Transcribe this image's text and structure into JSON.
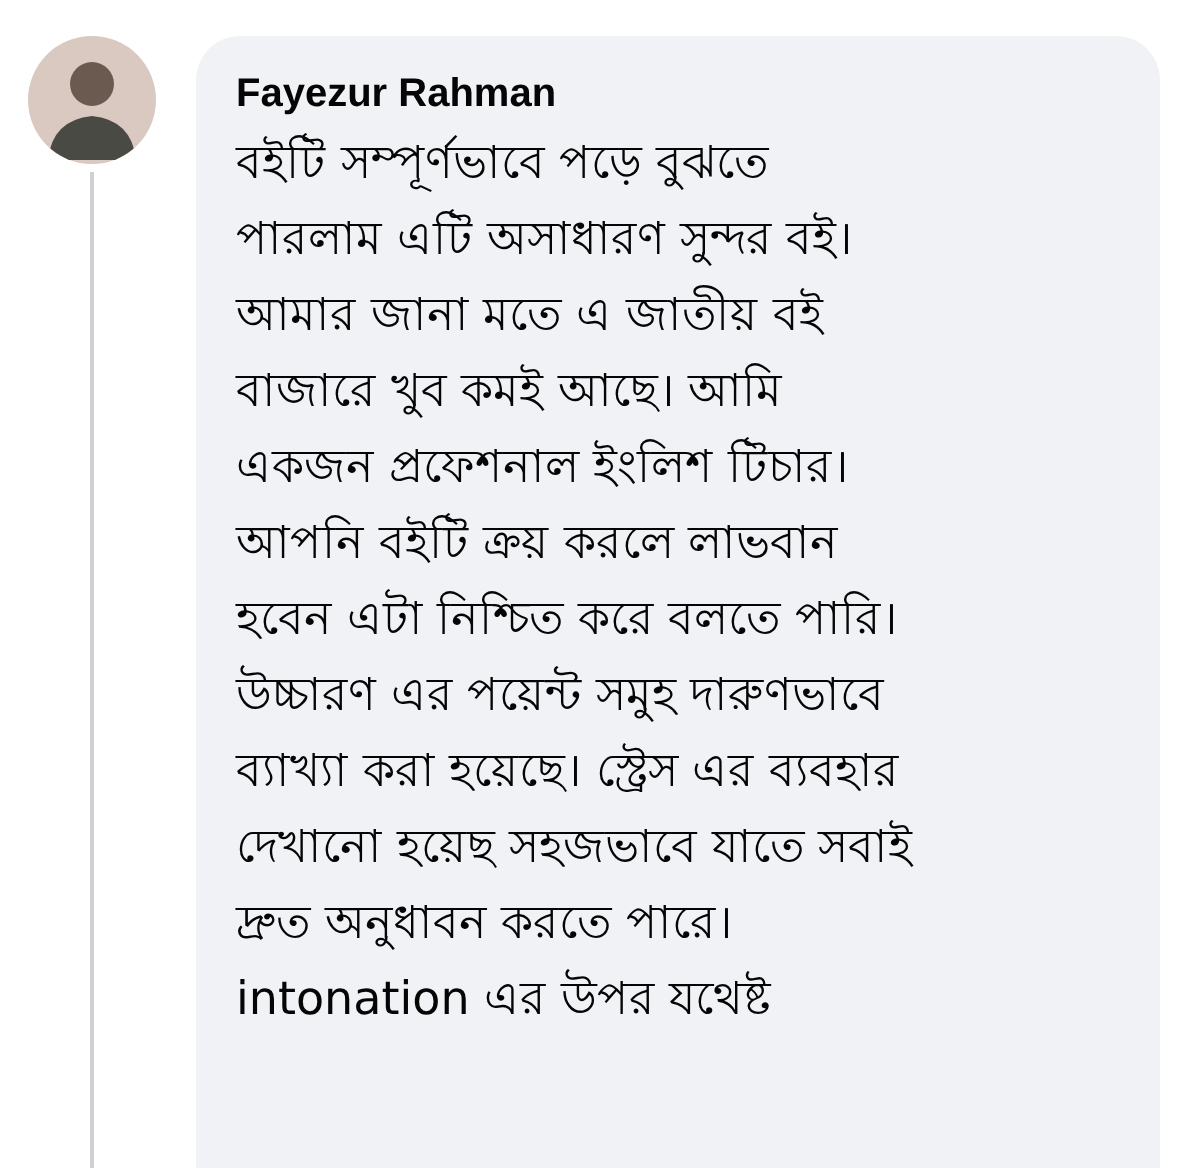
{
  "comment": {
    "author": "Fayezur Rahman",
    "text_lines": [
      "বইটি সম্পূর্ণভাবে পড়ে বুঝতে",
      "পারলাম এটি অসাধারণ সুন্দর বই।",
      "আমার জানা মতে এ জাতীয় বই",
      "বাজারে খুব কমই আছে। আমি",
      "একজন প্রফেশনাল ইংলিশ টিচার।",
      "আপনি বইটি ক্রয় করলে লাভবান",
      "হবেন এটা নিশ্চিত করে বলতে পারি।",
      "উচ্চারণ এর পয়েন্ট সমুহ দারুণভাবে",
      "ব্যাখ্যা করা হয়েছে। স্ট্রেস এর ব্যবহার",
      "দেখানো হয়েছ সহজভাবে যাতে সবাই",
      "দ্রুত অনুধাবন করতে পারে।",
      "intonation এর উপর যথেষ্ট"
    ]
  }
}
